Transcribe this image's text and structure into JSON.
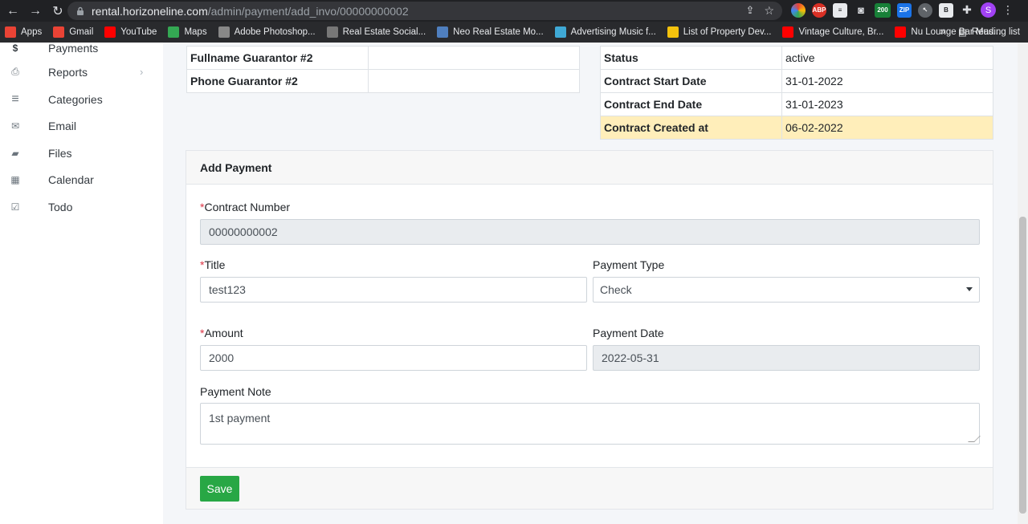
{
  "browser": {
    "url_host": "rental.horizoneline.com",
    "url_path": "/admin/payment/add_invo/00000000002",
    "profile_initial": "S",
    "ext_badge": "200",
    "ext_abp": "ABP",
    "ext_zip": "ZIP",
    "ext_b": "B"
  },
  "bookmarks": [
    {
      "label": "Apps",
      "color": "#ea4335"
    },
    {
      "label": "Gmail",
      "color": "#ea4335"
    },
    {
      "label": "YouTube",
      "color": "#ff0000"
    },
    {
      "label": "Maps",
      "color": "#34a853"
    },
    {
      "label": "Adobe Photoshop...",
      "color": "#888888"
    },
    {
      "label": "Real Estate Social...",
      "color": "#777777"
    },
    {
      "label": "Neo Real Estate Mo...",
      "color": "#4f7fbf"
    },
    {
      "label": "Advertising Music f...",
      "color": "#3fa9d6"
    },
    {
      "label": "List of Property Dev...",
      "color": "#f4c20d"
    },
    {
      "label": "Vintage Culture, Br...",
      "color": "#ff0000"
    },
    {
      "label": "Nu Lounge Bar Mus...",
      "color": "#ff0000"
    }
  ],
  "bookmarks_more": "»",
  "reading_list": "Reading list",
  "sidebar": {
    "items": [
      {
        "label": "Payments",
        "icon": "$"
      },
      {
        "label": "Reports",
        "icon": "⎙"
      },
      {
        "label": "Categories",
        "icon": "≡"
      },
      {
        "label": "Email",
        "icon": "✉"
      },
      {
        "label": "Files",
        "icon": "▰"
      },
      {
        "label": "Calendar",
        "icon": "▦"
      },
      {
        "label": "Todo",
        "icon": "☑"
      }
    ],
    "reports_arrow": "›"
  },
  "guarantor_table": [
    {
      "label": "Fullname Guarantor #2",
      "value": ""
    },
    {
      "label": "Phone Guarantor #2",
      "value": ""
    }
  ],
  "contract_table": [
    {
      "label": "Status",
      "value": "active"
    },
    {
      "label": "Contract Start Date",
      "value": "31-01-2022"
    },
    {
      "label": "Contract End Date",
      "value": "31-01-2023"
    },
    {
      "label": "Contract Created at",
      "value": "06-02-2022"
    }
  ],
  "form": {
    "title": "Add Payment",
    "required_mark": "*",
    "contract_number_label": "Contract Number",
    "contract_number_value": "00000000002",
    "title_label": "Title",
    "title_value": "test123",
    "payment_type_label": "Payment Type",
    "payment_type_value": "Check",
    "amount_label": "Amount",
    "amount_value": "2000",
    "payment_date_label": "Payment Date",
    "payment_date_value": "2022-05-31",
    "payment_note_label": "Payment Note",
    "payment_note_value": "1st payment",
    "save_label": "Save"
  },
  "colors": {
    "save_button": "#28a745",
    "highlight_row": "#ffeeba",
    "required": "#dc3545"
  }
}
